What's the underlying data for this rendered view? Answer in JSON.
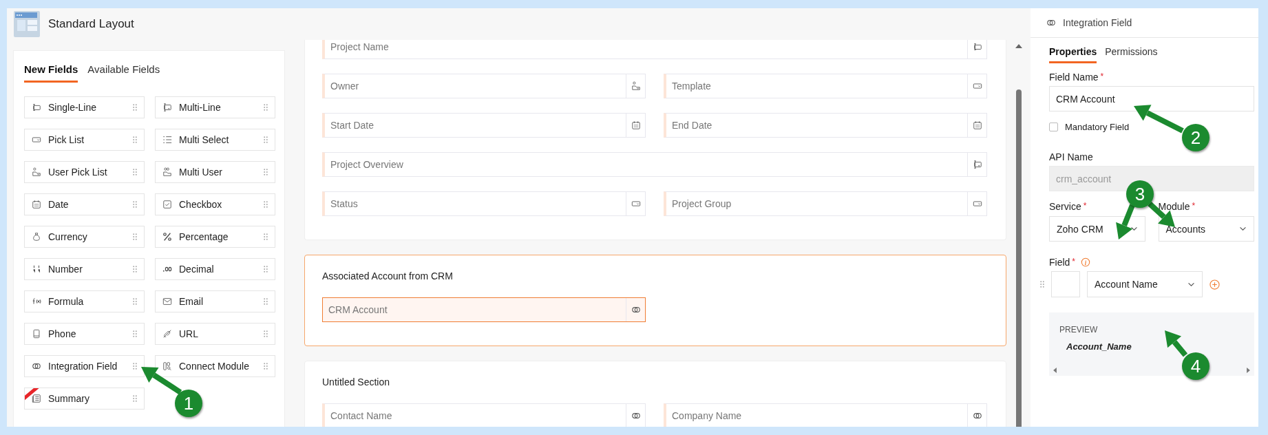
{
  "header": {
    "title": "Standard Layout"
  },
  "palette": {
    "tabs": [
      {
        "label": "New Fields",
        "selected": true
      },
      {
        "label": "Available Fields",
        "selected": false
      }
    ],
    "items": [
      {
        "label": "Single-Line",
        "kind": "single-line",
        "ribbon": false
      },
      {
        "label": "Multi-Line",
        "kind": "multi-line",
        "ribbon": false
      },
      {
        "label": "Pick List",
        "kind": "picklist",
        "ribbon": false
      },
      {
        "label": "Multi Select",
        "kind": "multiselect",
        "ribbon": false
      },
      {
        "label": "User Pick List",
        "kind": "user",
        "ribbon": false
      },
      {
        "label": "Multi User",
        "kind": "multiuser",
        "ribbon": false
      },
      {
        "label": "Date",
        "kind": "date",
        "ribbon": false
      },
      {
        "label": "Checkbox",
        "kind": "checkbox",
        "ribbon": false
      },
      {
        "label": "Currency",
        "kind": "currency",
        "ribbon": false
      },
      {
        "label": "Percentage",
        "kind": "percent",
        "ribbon": false
      },
      {
        "label": "Number",
        "kind": "number",
        "ribbon": false
      },
      {
        "label": "Decimal",
        "kind": "decimal",
        "ribbon": false
      },
      {
        "label": "Formula",
        "kind": "formula",
        "ribbon": false
      },
      {
        "label": "Email",
        "kind": "email",
        "ribbon": false
      },
      {
        "label": "Phone",
        "kind": "phone",
        "ribbon": false
      },
      {
        "label": "URL",
        "kind": "url",
        "ribbon": false
      },
      {
        "label": "Integration Field",
        "kind": "integration",
        "ribbon": false
      },
      {
        "label": "Connect Module",
        "kind": "connect",
        "ribbon": false
      },
      {
        "label": "Summary",
        "kind": "summary",
        "ribbon": true
      }
    ]
  },
  "sections": [
    {
      "selected": false,
      "rows": [
        [
          {
            "label": "Project Name",
            "kind": "single-line",
            "selected": false
          }
        ],
        [
          {
            "label": "Owner",
            "kind": "user",
            "selected": false
          },
          {
            "label": "Template",
            "kind": "picklist",
            "selected": false
          }
        ],
        [
          {
            "label": "Start Date",
            "kind": "date",
            "selected": false
          },
          {
            "label": "End Date",
            "kind": "date",
            "selected": false
          }
        ],
        [
          {
            "label": "Project Overview",
            "kind": "multi-line",
            "selected": false
          }
        ],
        [
          {
            "label": "Status",
            "kind": "picklist",
            "selected": false
          },
          {
            "label": "Project Group",
            "kind": "picklist",
            "selected": false
          }
        ]
      ]
    },
    {
      "title": "Associated Account from CRM",
      "selected": true,
      "rows": [
        [
          {
            "label": "CRM Account",
            "kind": "integration",
            "selected": true
          }
        ]
      ]
    },
    {
      "title": "Untitled Section",
      "selected": false,
      "rows": [
        [
          {
            "label": "Contact Name",
            "kind": "integration",
            "selected": false
          },
          {
            "label": "Company Name",
            "kind": "integration",
            "selected": false
          }
        ]
      ]
    }
  ],
  "properties": {
    "title": "Integration Field",
    "tabs": [
      {
        "label": "Properties",
        "selected": true
      },
      {
        "label": "Permissions",
        "selected": false
      }
    ],
    "field_name": {
      "label": "Field Name",
      "required_mark": "*",
      "value": "CRM Account"
    },
    "mandatory": {
      "label": "Mandatory Field",
      "checked": false
    },
    "api_name": {
      "label": "API Name",
      "value": "crm_account",
      "disabled": true
    },
    "service": {
      "label": "Service",
      "required_mark": "*",
      "value": "Zoho CRM"
    },
    "module": {
      "label": "Module",
      "required_mark": "*",
      "value": "Accounts"
    },
    "field": {
      "label": "Field",
      "required_mark": "*",
      "value": "Account Name"
    },
    "preview": {
      "label": "PREVIEW",
      "value": "Account_Name"
    }
  },
  "annotations": [
    {
      "number": "1"
    },
    {
      "number": "2"
    },
    {
      "number": "3"
    },
    {
      "number": "4"
    }
  ]
}
